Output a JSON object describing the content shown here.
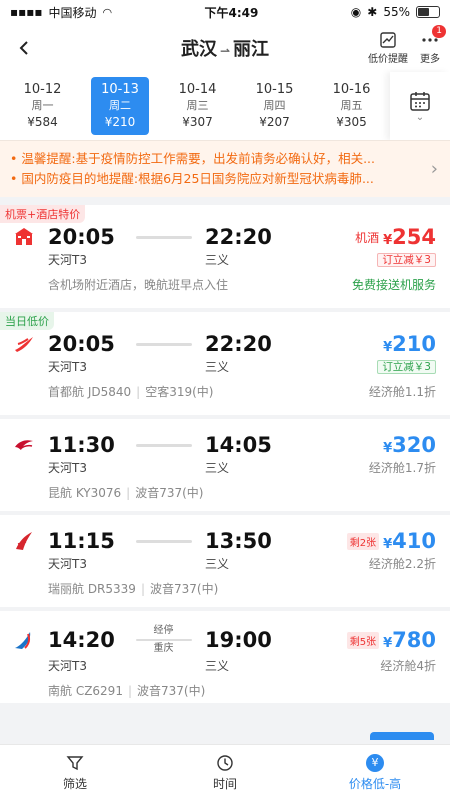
{
  "status": {
    "carrier": "中国移动",
    "time": "下午4:49",
    "battery": "55%"
  },
  "header": {
    "from": "武汉",
    "to": "丽江",
    "low_price_label": "低价提醒",
    "more_label": "更多",
    "badge": "1"
  },
  "dates": [
    {
      "date": "10-12",
      "weekday": "周一",
      "price": "¥584",
      "active": false
    },
    {
      "date": "10-13",
      "weekday": "周二",
      "price": "¥210",
      "active": true
    },
    {
      "date": "10-14",
      "weekday": "周三",
      "price": "¥307",
      "active": false
    },
    {
      "date": "10-15",
      "weekday": "周四",
      "price": "¥207",
      "active": false
    },
    {
      "date": "10-16",
      "weekday": "周五",
      "price": "¥305",
      "active": false
    }
  ],
  "notices": [
    {
      "label": "温馨提醒:",
      "text": "基于疫情防控工作需要，出发前请务必确认好，相关..."
    },
    {
      "label": "国内防疫目的地提醒:",
      "text": "根据6月25日国务院应对新型冠状病毒肺..."
    }
  ],
  "flights": [
    {
      "tag": "机票+酒店特价",
      "tag_type": "hotel",
      "dep_time": "20:05",
      "arr_time": "22:20",
      "dep_airport": "天河T3",
      "arr_airport": "三义",
      "price_prefix": "机酒",
      "price": "254",
      "price_color": "red",
      "discount": "订立减￥3",
      "discount_color": "red",
      "info": "含机场附近酒店，晚航班早点入住",
      "right_note": "免费接送机服务",
      "right_note_color": "green",
      "logo": "hotel-icon"
    },
    {
      "tag": "当日低价",
      "tag_type": "day",
      "dep_time": "20:05",
      "arr_time": "22:20",
      "dep_airport": "天河T3",
      "arr_airport": "三义",
      "price": "210",
      "price_color": "blue",
      "discount": "订立减￥3",
      "discount_color": "green",
      "airline": "首都航 JD5840",
      "aircraft": "空客319(中)",
      "cabin": "经济舱1.1折",
      "logo": "capital-airlines-logo"
    },
    {
      "dep_time": "11:30",
      "arr_time": "14:05",
      "dep_airport": "天河T3",
      "arr_airport": "三义",
      "price": "320",
      "price_color": "blue",
      "airline": "昆航 KY3076",
      "aircraft": "波音737(中)",
      "cabin": "经济舱1.7折",
      "logo": "kunming-airlines-logo"
    },
    {
      "dep_time": "11:15",
      "arr_time": "13:50",
      "dep_airport": "天河T3",
      "arr_airport": "三义",
      "price": "410",
      "price_color": "blue",
      "left_badge": "剩2张",
      "airline": "瑞丽航 DR5339",
      "aircraft": "波音737(中)",
      "cabin": "经济舱2.2折",
      "logo": "ruili-airlines-logo"
    },
    {
      "dep_time": "14:20",
      "arr_time": "19:00",
      "dep_airport": "天河T3",
      "arr_airport": "三义",
      "stop_label": "经停",
      "stop_city": "重庆",
      "price": "780",
      "price_color": "blue",
      "left_badge": "剩5张",
      "airline": "南航 CZ6291",
      "aircraft": "波音737(中)",
      "cabin": "经济舱4折",
      "logo": "china-southern-logo"
    }
  ],
  "bottom_tabs": [
    {
      "label": "筛选",
      "icon": "filter-icon",
      "active": false
    },
    {
      "label": "时间",
      "icon": "clock-icon",
      "active": false
    },
    {
      "label": "价格低-高",
      "icon": "yen-icon",
      "active": true
    }
  ]
}
